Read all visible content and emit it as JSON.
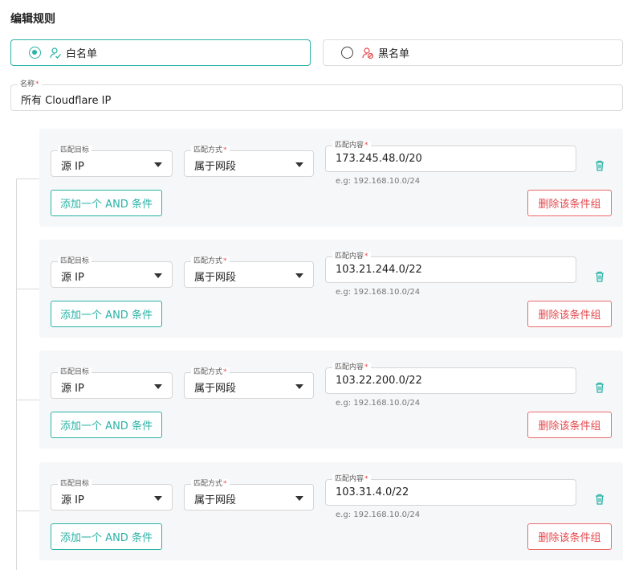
{
  "page": {
    "title": "编辑规则"
  },
  "rule_type": {
    "whitelist_label": "白名单",
    "blacklist_label": "黑名单",
    "selected": "whitelist"
  },
  "name_field": {
    "label": "名称",
    "value": "所有 Cloudflare IP"
  },
  "field_labels": {
    "target": "匹配目标",
    "method": "匹配方式",
    "content": "匹配内容"
  },
  "helper_text": "e.g: 192.168.10.0/24",
  "buttons": {
    "add_and": "添加一个 AND 条件",
    "delete_group": "删除该条件组"
  },
  "groups": [
    {
      "target": "源 IP",
      "method": "属于网段",
      "content": "173.245.48.0/20"
    },
    {
      "target": "源 IP",
      "method": "属于网段",
      "content": "103.21.244.0/22"
    },
    {
      "target": "源 IP",
      "method": "属于网段",
      "content": "103.22.200.0/22"
    },
    {
      "target": "源 IP",
      "method": "属于网段",
      "content": "103.31.4.0/22"
    }
  ],
  "colors": {
    "accent": "#2ab3a6",
    "danger": "#e5484d",
    "group_bg": "#f6f7f9"
  },
  "icons": {
    "whitelist": "user-check-icon",
    "blacklist": "user-block-icon",
    "delete": "trash-icon",
    "dropdown": "caret-down-icon"
  }
}
